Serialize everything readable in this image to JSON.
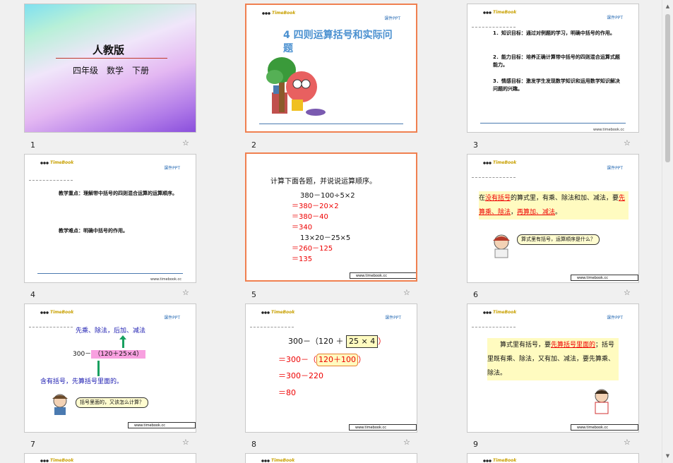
{
  "logo_text": "TimeBook",
  "courseware_label": "课件PPT",
  "site_url": "www.timebook.cc",
  "slides": [
    {
      "num": "1",
      "title": "人教版",
      "subtitle": "四年级　数学　下册"
    },
    {
      "num": "2",
      "title": "4 四则运算括号和实际问题"
    },
    {
      "num": "3",
      "goals": [
        "1．知识目标：通过对例题的学习，明确中括号的作用。",
        "2．能力目标：培养正确计算带中括号的四则混合运算式题能力。",
        "3．情感目标：激发学生发现数学知识和运用数学知识解决问题的兴趣。"
      ]
    },
    {
      "num": "4",
      "key_point": "教学重点：理解带中括号的四则混合运算的运算顺序。",
      "difficult_point": "教学难点：明确中括号的作用。"
    },
    {
      "num": "5",
      "instruction": "计算下面各题，并说说运算顺序。",
      "lines": [
        "380－100÷5×2",
        "＝380－20×2",
        "＝380－40",
        "＝340",
        "13×20－25×5",
        "＝260－125",
        "＝135"
      ]
    },
    {
      "num": "6",
      "text_pre": "在",
      "text_a": "没有括号",
      "text_b": "的算式里，有乘、除法和加、减法，要",
      "text_c": "先算乘、除法",
      "text_d": "，",
      "text_e": "再算加、减法",
      "text_f": "。",
      "bubble": "算式里有括号，运算顺序是什么？"
    },
    {
      "num": "7",
      "top_text": "先乘、除法，后加、减法",
      "expr_prefix": "300－",
      "expr_box": "（120＋25×4）",
      "bottom_text": "含有括号，先算括号里面的。",
      "bubble": "括号里面的，又该怎么计算？"
    },
    {
      "num": "8",
      "line1_a": "300－（120 ＋",
      "line1_box": "25 × 4",
      "line1_b": "）",
      "line2_a": "＝300－（",
      "line2_oval": "120＋100",
      "line2_b": "）",
      "line3": "＝300－220",
      "line4": "＝80"
    },
    {
      "num": "9",
      "text_a": "算式里有括号，要",
      "text_b": "先算括号里面的",
      "text_c": "；括号里既有乘、除法，又有加、减法，要先算乘、除法。"
    }
  ],
  "star_icon": "☆"
}
